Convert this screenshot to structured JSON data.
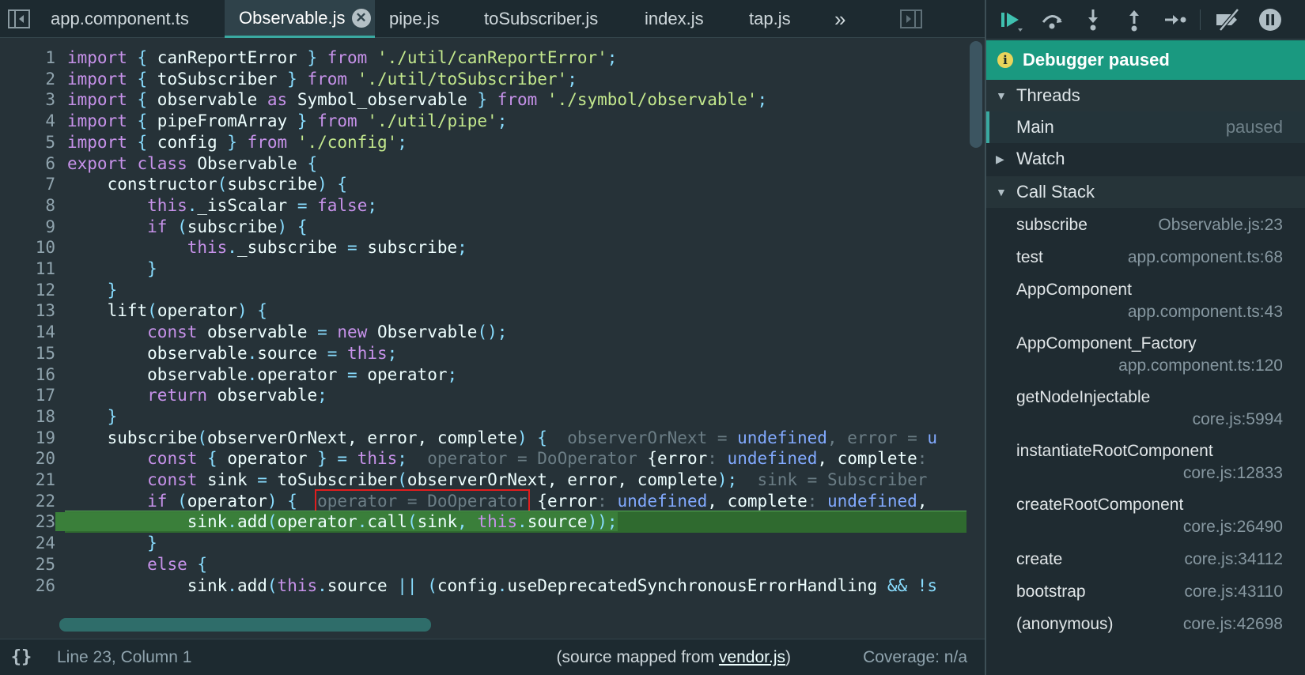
{
  "tabs": [
    {
      "label": "app.component.ts",
      "active": false
    },
    {
      "label": "Observable.js",
      "active": true
    },
    {
      "label": "pipe.js",
      "active": false
    },
    {
      "label": "toSubscriber.js",
      "active": false
    },
    {
      "label": "index.js",
      "active": false
    },
    {
      "label": "tap.js",
      "active": false
    }
  ],
  "tabs_overflow": "»",
  "line_numbers": [
    "1",
    "2",
    "3",
    "4",
    "5",
    "6",
    "7",
    "8",
    "9",
    "10",
    "11",
    "12",
    "13",
    "14",
    "15",
    "16",
    "17",
    "18",
    "19",
    "20",
    "21",
    "22",
    "23",
    "24",
    "25",
    "26"
  ],
  "code": {
    "l1": [
      "import",
      " { ",
      "canReportError",
      " } ",
      "from",
      " ",
      "'./util/canReportError'",
      ";"
    ],
    "l2": [
      "import",
      " { ",
      "toSubscriber",
      " } ",
      "from",
      " ",
      "'./util/toSubscriber'",
      ";"
    ],
    "l3": [
      "import",
      " { ",
      "observable",
      " as ",
      "Symbol_observable",
      " } ",
      "from",
      " ",
      "'./symbol/observable'",
      ";"
    ],
    "l4": [
      "import",
      " { ",
      "pipeFromArray",
      " } ",
      "from",
      " ",
      "'./util/pipe'",
      ";"
    ],
    "l5": [
      "import",
      " { ",
      "config",
      " } ",
      "from",
      " ",
      "'./config'",
      ";"
    ],
    "l6": [
      "export class",
      " Observable ",
      "{"
    ],
    "l7": [
      "    constructor",
      "(",
      "subscribe",
      ") {"
    ],
    "l8": [
      "        ",
      "this",
      ".",
      "_isScalar",
      " = ",
      "false",
      ";"
    ],
    "l9": [
      "        ",
      "if",
      " (",
      "subscribe",
      ") {"
    ],
    "l10": [
      "            ",
      "this",
      ".",
      "_subscribe",
      " = ",
      "subscribe",
      ";"
    ],
    "l11": [
      "        }"
    ],
    "l12": [
      "    }"
    ],
    "l13": [
      "    lift",
      "(",
      "operator",
      ") {"
    ],
    "l14": [
      "        ",
      "const",
      " ",
      "observable",
      " = ",
      "new",
      " ",
      "Observable",
      "();"
    ],
    "l15": [
      "        ",
      "observable",
      ".",
      "source",
      " = ",
      "this",
      ";"
    ],
    "l16": [
      "        ",
      "observable",
      ".",
      "operator",
      " = ",
      "operator",
      ";"
    ],
    "l17": [
      "        ",
      "return",
      " ",
      "observable",
      ";"
    ],
    "l18": [
      "    }"
    ],
    "l19": [
      "    subscribe",
      "(",
      "observerOrNext, error, complete",
      ") {"
    ],
    "l19_dbg": [
      "observerOrNext",
      " = ",
      "undefined",
      ", ",
      "error",
      " = ",
      "u"
    ],
    "l20": [
      "        ",
      "const",
      " { ",
      "operator",
      " } = ",
      "this",
      ";"
    ],
    "l20_dbg": [
      "operator = DoOperator",
      " {",
      "error",
      ": ",
      "undefined",
      ", ",
      "complete",
      ": "
    ],
    "l21": [
      "        ",
      "const",
      " ",
      "sink",
      " = ",
      "toSubscriber",
      "(",
      "observerOrNext, error, complete",
      ");"
    ],
    "l21_dbg": [
      "sink = Subscriber"
    ],
    "l22": [
      "        ",
      "if",
      " (",
      "operator",
      ") {"
    ],
    "l22_dbg": [
      "operator = DoOperator",
      " {",
      "error",
      ": ",
      "undefined",
      ", ",
      "complete",
      ": ",
      "undefined",
      ","
    ],
    "l23": [
      "            ",
      "sink",
      ".",
      "add",
      "(",
      "operator",
      ".",
      "call",
      "(",
      "sink",
      ", ",
      "this",
      ".",
      "source",
      "));"
    ],
    "l24": [
      "        }"
    ],
    "l25": [
      "        ",
      "else",
      " {"
    ],
    "l26": [
      "            ",
      "sink",
      ".",
      "add",
      "(",
      "this",
      ".",
      "source",
      " || (",
      "config",
      ".",
      "useDeprecatedSynchronousErrorHandling",
      " && !s"
    ]
  },
  "status": {
    "format_button": "{}",
    "cursor": "Line 23, Column 1",
    "mapped_prefix": "(source mapped from ",
    "mapped_link": "vendor.js",
    "mapped_suffix": ")",
    "coverage": "Coverage: n/a"
  },
  "debugger": {
    "banner": "Debugger paused",
    "banner_icon": "i",
    "threads_label": "Threads",
    "thread_name": "Main",
    "thread_state": "paused",
    "watch_label": "Watch",
    "callstack_label": "Call Stack",
    "frames": [
      {
        "fn": "subscribe",
        "loc": "Observable.js:23"
      },
      {
        "fn": "test",
        "loc": "app.component.ts:68"
      },
      {
        "fn": "AppComponent",
        "loc": "app.component.ts:43"
      },
      {
        "fn": "AppComponent_Factory",
        "loc": "app.component.ts:120"
      },
      {
        "fn": "getNodeInjectable",
        "loc": "core.js:5994"
      },
      {
        "fn": "instantiateRootComponent",
        "loc": "core.js:12833"
      },
      {
        "fn": "createRootComponent",
        "loc": "core.js:26490"
      },
      {
        "fn": "create",
        "loc": "core.js:34112"
      },
      {
        "fn": "bootstrap",
        "loc": "core.js:43110"
      },
      {
        "fn": "(anonymous)",
        "loc": "core.js:42698"
      }
    ]
  },
  "colors": {
    "editor_bg": "#263238",
    "exec_line": "#3a7f3a",
    "banner": "#1a9980",
    "accent": "#3aa9a1",
    "highlight_box": "#e01e1e"
  }
}
